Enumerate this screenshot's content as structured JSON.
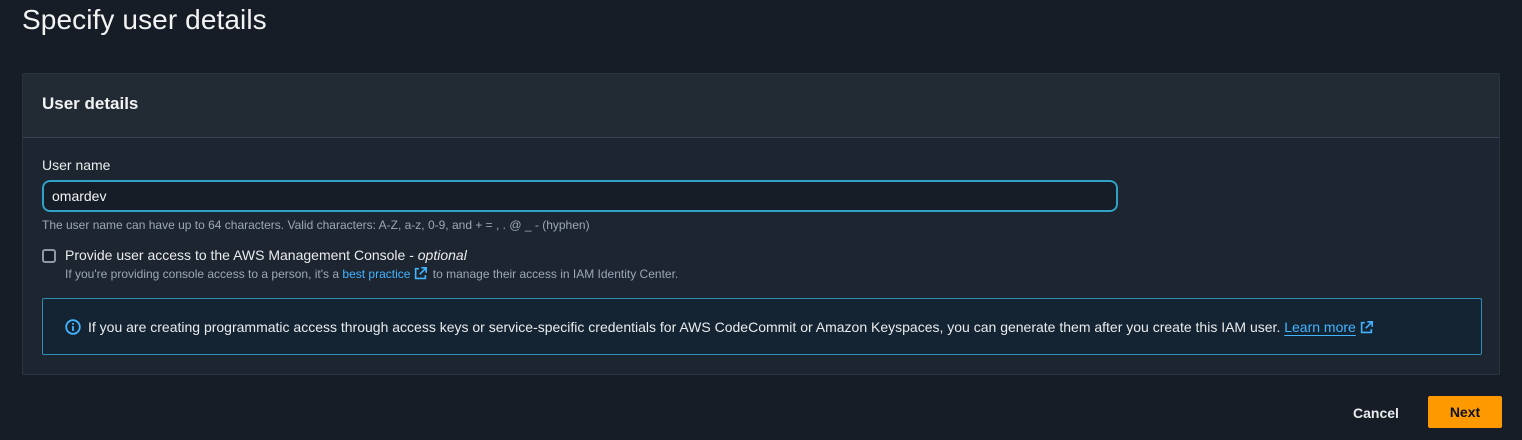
{
  "page": {
    "title": "Specify user details"
  },
  "user_details": {
    "panel_title": "User details",
    "user_name": {
      "label": "User name",
      "value": "omardev",
      "hint": "The user name can have up to 64 characters. Valid characters: A-Z, a-z, 0-9, and + = , . @ _ - (hyphen)"
    },
    "console_access": {
      "checked": false,
      "label": "Provide user access to the AWS Management Console - ",
      "label_optional": "optional",
      "desc_prefix": "If you're providing console access to a person, it's a ",
      "desc_link": "best practice",
      "desc_suffix": " to manage their access in IAM Identity Center."
    },
    "info": {
      "text": "If you are creating programmatic access through access keys or service-specific credentials for AWS CodeCommit or Amazon Keyspaces, you can generate them after you create this IAM user. ",
      "link": "Learn more"
    }
  },
  "actions": {
    "cancel_label": "Cancel",
    "next_label": "Next"
  },
  "icons": {
    "info": "info-icon",
    "external_link": "external-link-icon"
  },
  "colors": {
    "accent": "#ff9900",
    "link": "#42b4ff",
    "focus_border": "#2ea3c7",
    "info_border": "#2c8fb3"
  }
}
